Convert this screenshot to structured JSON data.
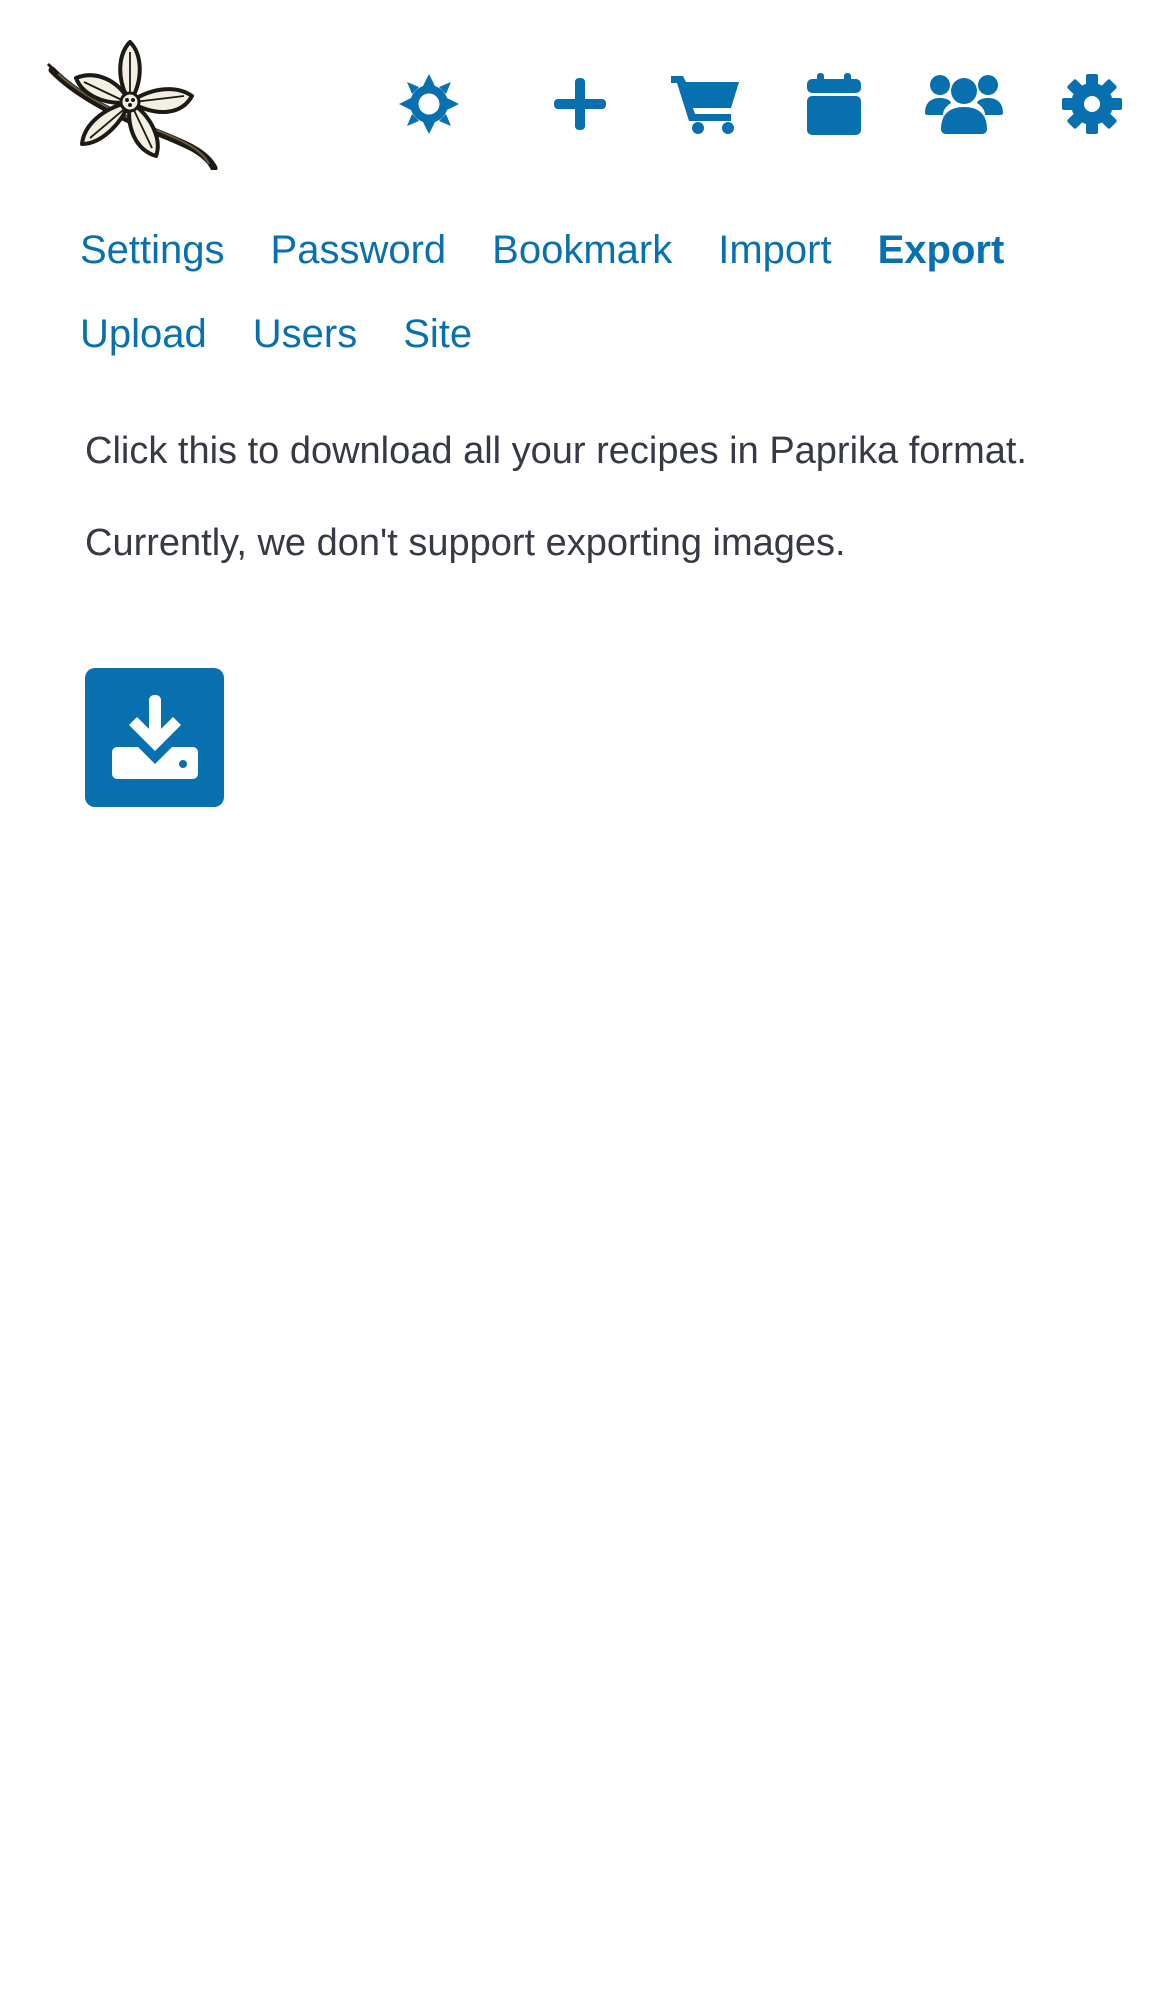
{
  "header": {
    "logo_alt": "vanilla flower logo",
    "icons": [
      "theme-icon",
      "add-icon",
      "cart-icon",
      "calendar-icon",
      "users-icon",
      "settings-icon"
    ]
  },
  "tabs": {
    "row1": [
      "Settings",
      "Password",
      "Bookmark",
      "Import",
      "Export"
    ],
    "row2": [
      "Upload",
      "Users",
      "Site"
    ],
    "active": "Export"
  },
  "content": {
    "paragraph1": "Click this to download all your recipes in Paprika format.",
    "paragraph2": "Currently, we don't support exporting images.",
    "download_icon": "download-icon"
  },
  "colors": {
    "accent": "#0970b0",
    "text": "#363a45",
    "background": "#ffffff"
  }
}
